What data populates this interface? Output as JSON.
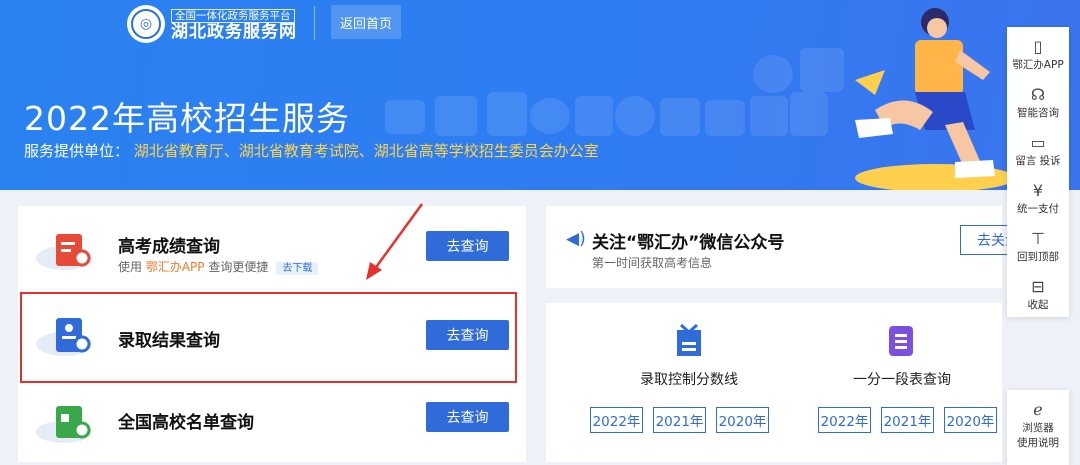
{
  "header": {
    "logo_small": "全国一体化政务服务平台",
    "logo_big": "湖北政务服务网",
    "back_home": "返回首页",
    "title": "2022年高校招生服务",
    "provider_label": "服务提供单位：",
    "provider_value": "湖北省教育厅、湖北省教育考试院、湖北省高等学校招生委员会办公室"
  },
  "services": [
    {
      "name": "高考成绩查询",
      "sub_prefix": "使用 ",
      "sub_app": "鄂汇办APP",
      "sub_suffix": " 查询更便捷",
      "download": "去下载",
      "button": "去查询"
    },
    {
      "name": "录取结果查询",
      "button": "去查询"
    },
    {
      "name": "全国高校名单查询",
      "button": "去查询"
    }
  ],
  "wechat": {
    "title": "关注“鄂汇办”微信公众号",
    "subtitle": "第一时间获取高考信息",
    "button": "去关注"
  },
  "lookups": [
    {
      "name": "录取控制分数线",
      "years": [
        "2022年",
        "2021年",
        "2020年"
      ],
      "icon": "document-check-icon",
      "color": "#2f6bd9"
    },
    {
      "name": "一分一段表查询",
      "years": [
        "2022年",
        "2021年",
        "2020年"
      ],
      "icon": "list-icon",
      "color": "#7b4fe0"
    }
  ],
  "sidebar": {
    "items": [
      {
        "label": "鄂汇办APP",
        "icon": "phone-icon"
      },
      {
        "label": "智能咨询",
        "icon": "headset-icon"
      },
      {
        "label": "留言 投诉",
        "icon": "message-icon"
      },
      {
        "label": "统一支付",
        "icon": "yuan-icon"
      },
      {
        "label": "回到顶部",
        "icon": "top-icon"
      },
      {
        "label": "收起",
        "icon": "collapse-icon"
      }
    ],
    "browser_label_1": "浏览器",
    "browser_label_2": "使用说明"
  },
  "colors": {
    "primary": "#2f6bd9",
    "highlight": "#e5322d",
    "app_orange": "#f07a2a",
    "banner": "#2f7cf2"
  }
}
